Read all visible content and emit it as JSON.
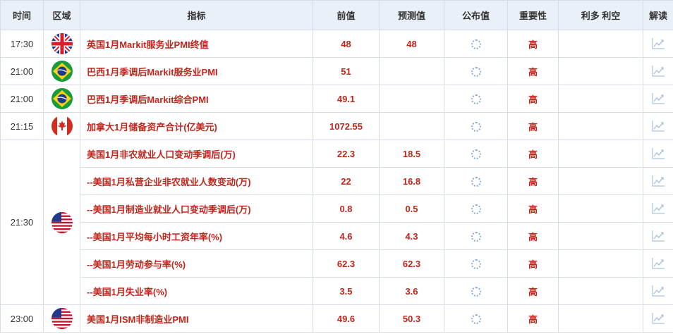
{
  "header": {
    "time": "时间",
    "region": "区域",
    "indicator": "指标",
    "previous": "前值",
    "forecast": "预测值",
    "actual": "公布值",
    "importance": "重要性",
    "impact": "利多 利空",
    "interpret": "解读"
  },
  "rows": [
    {
      "time": "17:30",
      "flag": "uk-flag-icon",
      "name": "英国1月Markit服务业PMI终值",
      "previous": "48",
      "forecast": "48",
      "importance": "高"
    },
    {
      "time": "21:00",
      "flag": "brazil-flag-icon",
      "name": "巴西1月季调后Markit服务业PMI",
      "previous": "51",
      "forecast": "",
      "importance": "高"
    },
    {
      "time": "21:00",
      "flag": "brazil-flag-icon",
      "name": "巴西1月季调后Markit综合PMI",
      "previous": "49.1",
      "forecast": "",
      "importance": "高"
    },
    {
      "time": "21:15",
      "flag": "canada-flag-icon",
      "name": "加拿大1月储备资产合计(亿美元)",
      "previous": "1072.55",
      "forecast": "",
      "importance": "高"
    },
    {
      "time": "21:30",
      "flag": "us-flag-icon",
      "name": "美国1月非农就业人口变动季调后(万)",
      "previous": "22.3",
      "forecast": "18.5",
      "importance": "高"
    },
    {
      "time": "",
      "flag": "",
      "name": "--美国1月私营企业非农就业人数变动(万)",
      "previous": "22",
      "forecast": "16.8",
      "importance": "高"
    },
    {
      "time": "",
      "flag": "",
      "name": "--美国1月制造业就业人口变动季调后(万)",
      "previous": "0.8",
      "forecast": "0.5",
      "importance": "高"
    },
    {
      "time": "",
      "flag": "",
      "name": "--美国1月平均每小时工资年率(%)",
      "previous": "4.6",
      "forecast": "4.3",
      "importance": "高"
    },
    {
      "time": "",
      "flag": "",
      "name": "--美国1月劳动参与率(%)",
      "previous": "62.3",
      "forecast": "62.3",
      "importance": "高"
    },
    {
      "time": "",
      "flag": "",
      "name": "--美国1月失业率(%)",
      "previous": "3.5",
      "forecast": "3.6",
      "importance": "高"
    },
    {
      "time": "23:00",
      "flag": "us-flag-icon",
      "name": "美国1月ISM非制造业PMI",
      "previous": "49.6",
      "forecast": "50.3",
      "importance": "高"
    }
  ],
  "colors": {
    "accent": "#c0261c",
    "header_bg": "#e9f0f8",
    "border": "#d6dde6"
  }
}
